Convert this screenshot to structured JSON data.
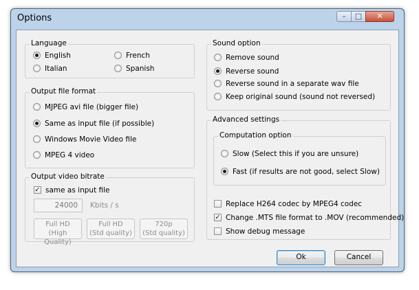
{
  "window": {
    "title": "Options",
    "minimize": "–",
    "maximize": "□",
    "close": "✕"
  },
  "language": {
    "legend": "Language",
    "options": [
      {
        "label": "English",
        "selected": true
      },
      {
        "label": "French",
        "selected": false
      },
      {
        "label": "Italian",
        "selected": false
      },
      {
        "label": "Spanish",
        "selected": false
      }
    ]
  },
  "output_format": {
    "legend": "Output file format",
    "options": [
      {
        "label": "MJPEG avi file (bigger file)",
        "selected": false
      },
      {
        "label": "Same as input file (if possible)",
        "selected": true
      },
      {
        "label": "Windows Movie Video file",
        "selected": false
      },
      {
        "label": "MPEG 4 video",
        "selected": false
      }
    ]
  },
  "bitrate": {
    "legend": "Output video bitrate",
    "same_as_input_label": "same as input file",
    "same_as_input_checked": true,
    "value": "24000",
    "unit": "Kbits / s",
    "presets": [
      {
        "line1": "Full HD",
        "line2": "(High Quality)"
      },
      {
        "line1": "Full HD",
        "line2": "(Std quality)"
      },
      {
        "line1": "720p",
        "line2": "(Std quality)"
      }
    ]
  },
  "sound": {
    "legend": "Sound option",
    "options": [
      {
        "label": "Remove sound",
        "selected": false
      },
      {
        "label": "Reverse sound",
        "selected": true
      },
      {
        "label": "Reverse sound in a separate wav file",
        "selected": false
      },
      {
        "label": "Keep original sound (sound not reversed)",
        "selected": false
      }
    ]
  },
  "advanced": {
    "legend": "Advanced settings",
    "computation": {
      "legend": "Computation option",
      "options": [
        {
          "label": "Slow (Select this if you are unsure)",
          "selected": false
        },
        {
          "label": "Fast (if results are not good, select Slow)",
          "selected": true
        }
      ]
    },
    "checks": [
      {
        "label": "Replace H264 codec by MPEG4 codec",
        "checked": false
      },
      {
        "label": "Change .MTS file format to .MOV (recommended)",
        "checked": true
      },
      {
        "label": "Show debug message",
        "checked": false
      }
    ]
  },
  "buttons": {
    "ok": "Ok",
    "cancel": "Cancel"
  }
}
